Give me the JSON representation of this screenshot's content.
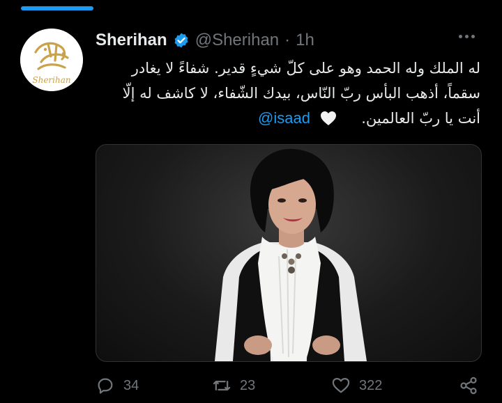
{
  "tweet": {
    "author_name": "Sherihan",
    "handle": "@Sherihan",
    "separator": "·",
    "time": "1h",
    "avatar_text": "Sherihan",
    "text_lines": [
      "له الملك وله الحمد وهو على كلّ شيءٍ قدير. شفاءً لا يغادر",
      "سقماً، أذهب البأس ربّ النّاس، بيدك الشّفاء، لا كاشف له إلّا",
      "أنت يا ربّ العالمين."
    ],
    "mention": "@isaad",
    "image_label": "Photo of a woman with short black hair wearing a white scarf and black vest"
  },
  "actions": {
    "reply_count": "34",
    "retweet_count": "23",
    "like_count": "322"
  },
  "colors": {
    "accent": "#1d9bf0",
    "muted": "#71767b",
    "text": "#e7e9ea",
    "background": "#000000"
  },
  "icons": [
    "verified-badge-icon",
    "more-icon",
    "white-heart-emoji",
    "reply-icon",
    "retweet-icon",
    "like-icon",
    "share-icon"
  ]
}
